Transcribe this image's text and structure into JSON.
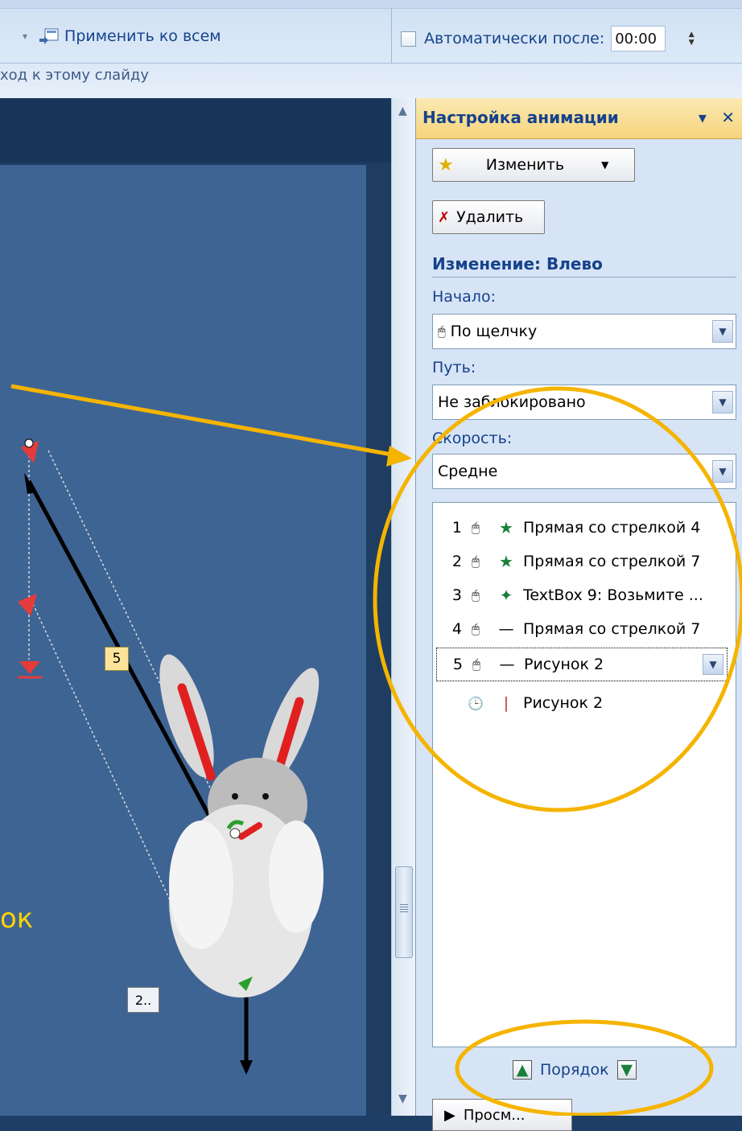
{
  "ribbon": {
    "apply_all_label": "Применить ко всем",
    "auto_after_label": "Автоматически после:",
    "auto_after_value": "00:00",
    "group_label": "ход к этому слайду"
  },
  "slide": {
    "text_fragment": "ок",
    "label_5": "5",
    "label_2": "2.."
  },
  "pane": {
    "title": "Настройка анимации",
    "change_button": "Изменить",
    "delete_button": "Удалить",
    "section_title": "Изменение: Влево",
    "start_label": "Начало:",
    "start_value": "По щелчку",
    "path_label": "Путь:",
    "path_value": "Не заблокировано",
    "speed_label": "Скорость:",
    "speed_value": "Средне",
    "items": [
      {
        "num": "1",
        "label": "Прямая со стрелкой 4"
      },
      {
        "num": "2",
        "label": "Прямая со стрелкой 7"
      },
      {
        "num": "3",
        "label": "TextBox 9: Возьмите ..."
      },
      {
        "num": "4",
        "label": "Прямая со стрелкой 7"
      },
      {
        "num": "5",
        "label": "Рисунок 2"
      },
      {
        "num": "",
        "label": "Рисунок 2"
      }
    ],
    "order_label": "Порядок",
    "preview_label": "Просм..."
  },
  "colors": {
    "annotation": "#f5b400",
    "slide_bg": "#3e6494",
    "pane_title": "#15428b"
  }
}
